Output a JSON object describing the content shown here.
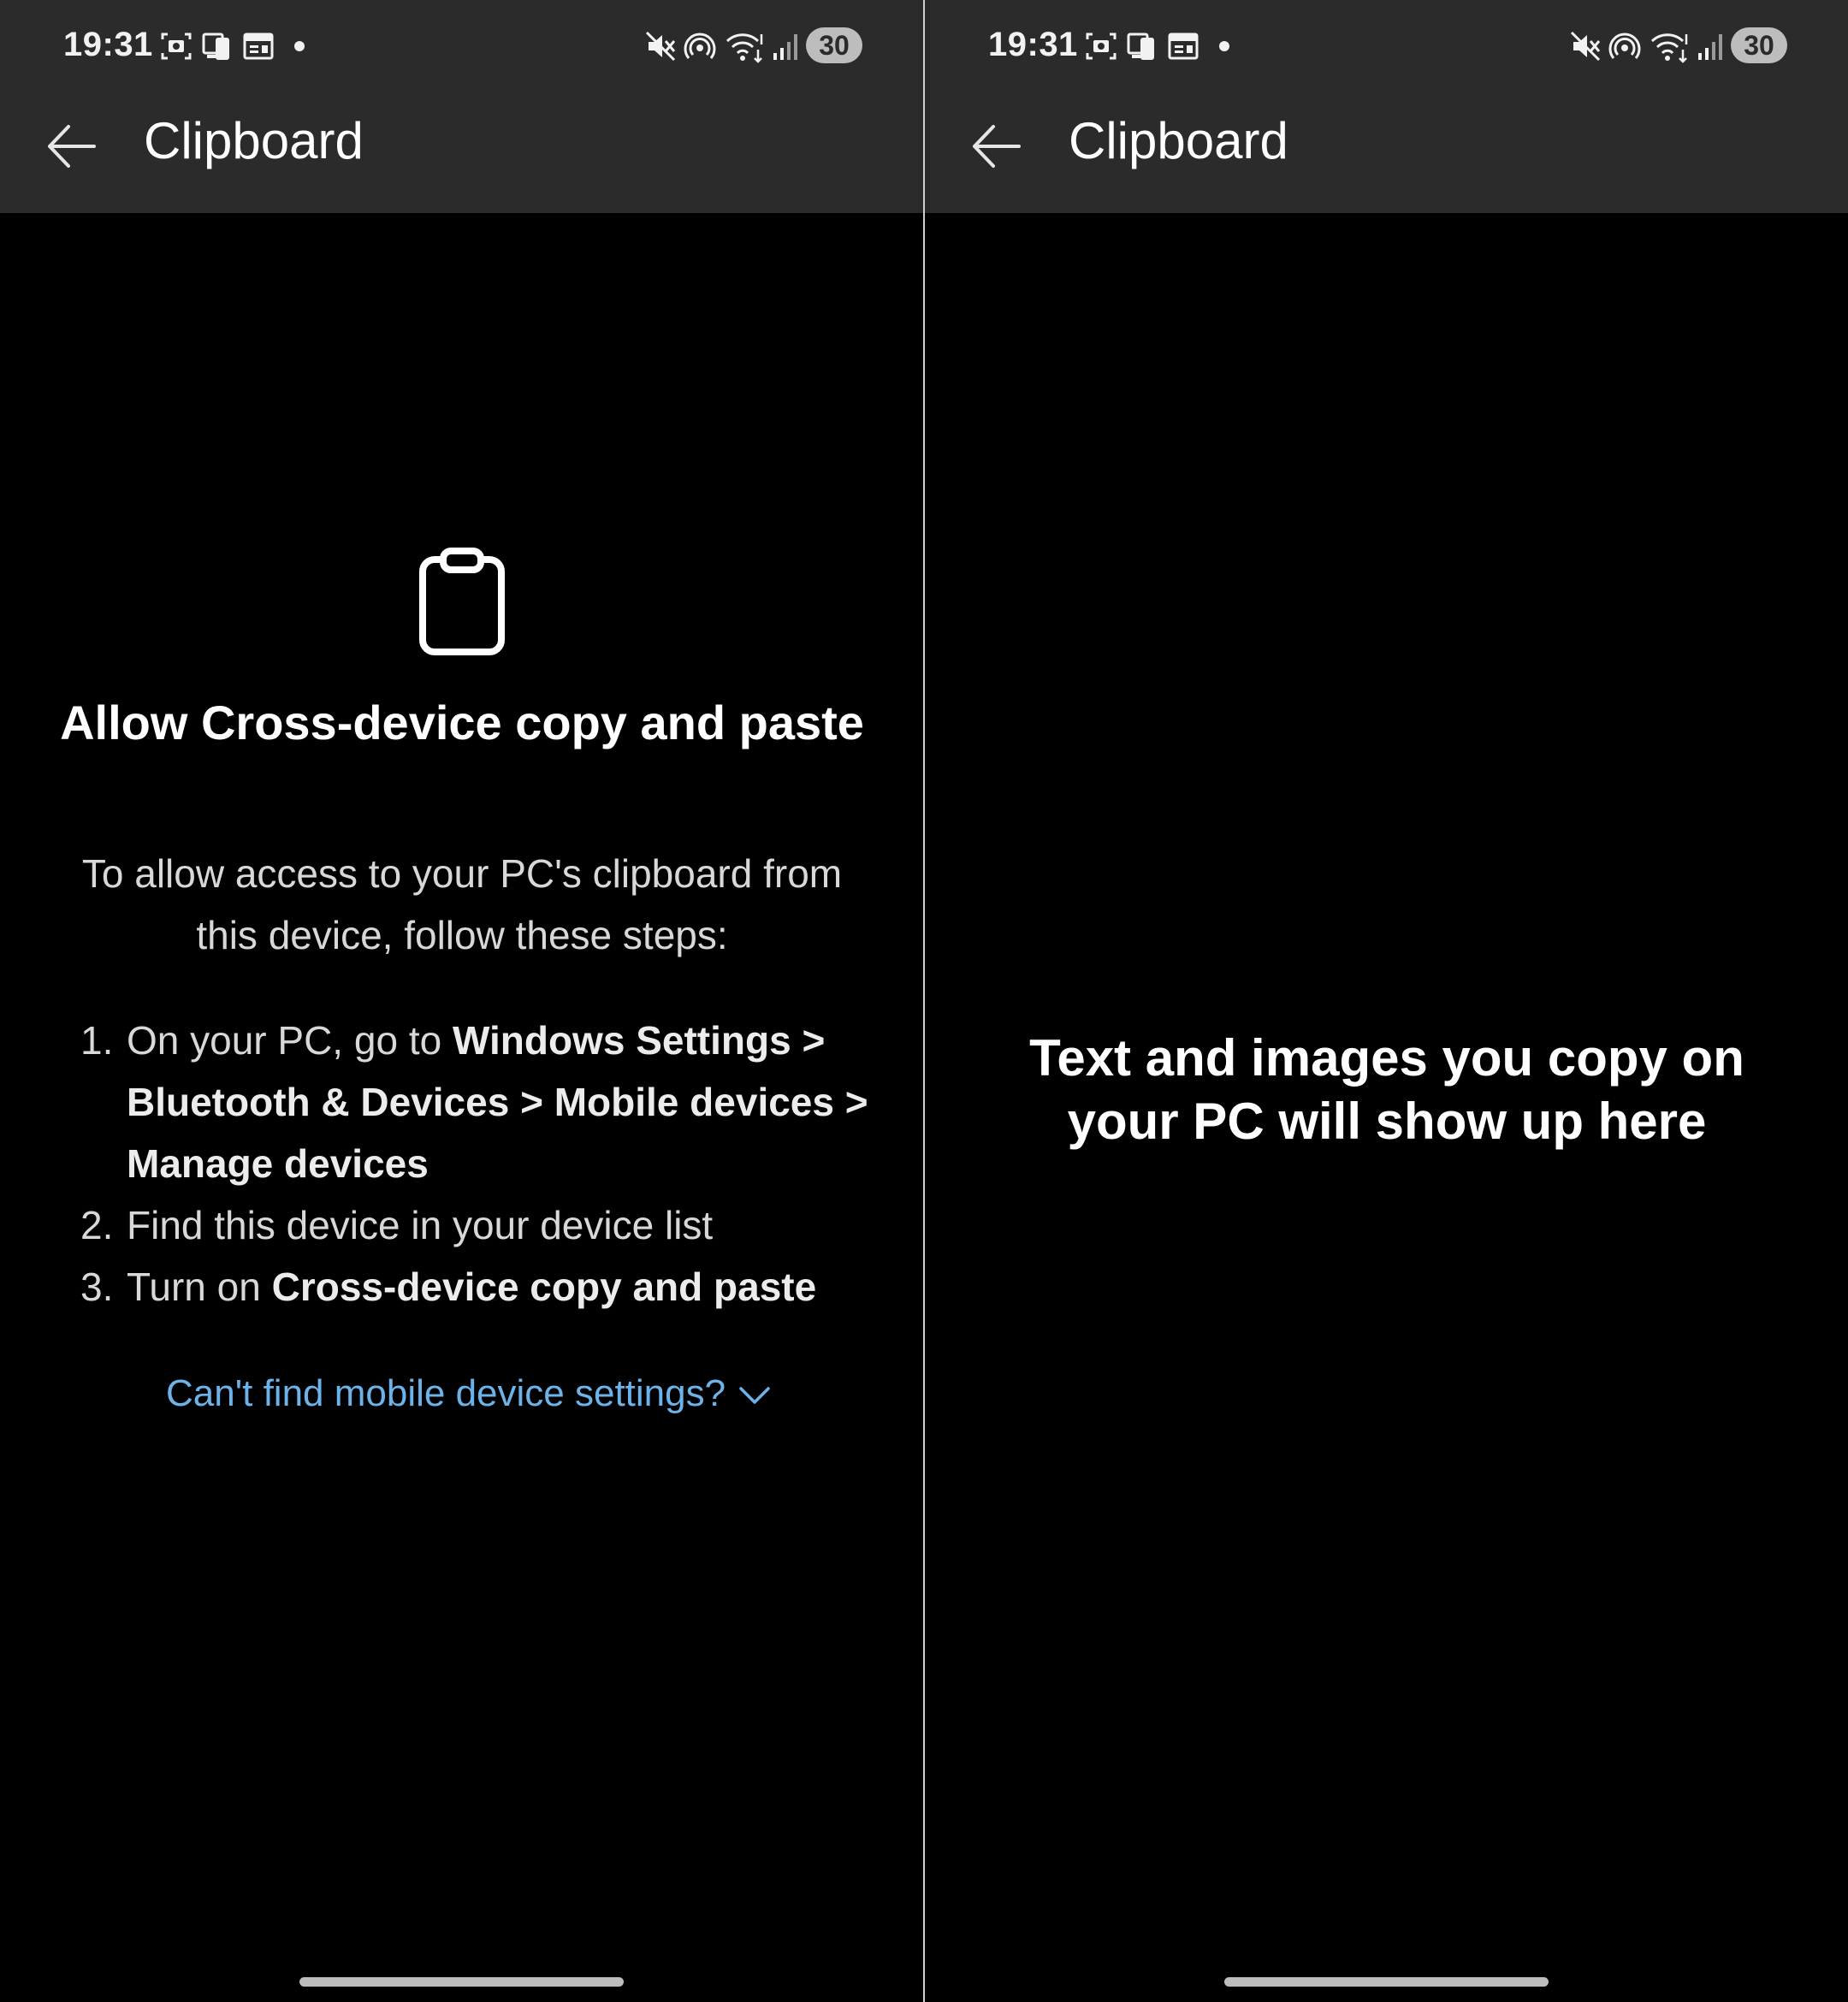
{
  "status_bar": {
    "time": "19:31",
    "battery": "30",
    "left_icons": [
      "screenshot-icon",
      "phone-link-icon",
      "calendar-icon",
      "notification-dot"
    ],
    "right_icons": [
      "mute-icon",
      "hotspot-icon",
      "wifi-icon",
      "signal-icon"
    ]
  },
  "left_screen": {
    "title": "Clipboard",
    "heading": "Allow Cross-device copy and paste",
    "subtext": "To allow access to your PC's clipboard from this device, follow these steps:",
    "steps": [
      {
        "number": "1.",
        "text_plain": "On your PC, go to ",
        "text_bold": "Windows Settings > Bluetooth & Devices > Mobile devices > Manage devices"
      },
      {
        "number": "2.",
        "text_plain": "Find this device in your device list",
        "text_bold": ""
      },
      {
        "number": "3.",
        "text_plain": "Turn on ",
        "text_bold": "Cross-device copy and paste"
      }
    ],
    "help_link": "Can't find mobile device settings?"
  },
  "right_screen": {
    "title": "Clipboard",
    "empty_message": "Text and images you copy on your PC will show up here"
  },
  "colors": {
    "header_bg": "#2b2b2b",
    "background": "#000000",
    "link": "#6cb3ea",
    "text_primary": "#ffffff",
    "text_secondary": "#d8d8d8"
  }
}
